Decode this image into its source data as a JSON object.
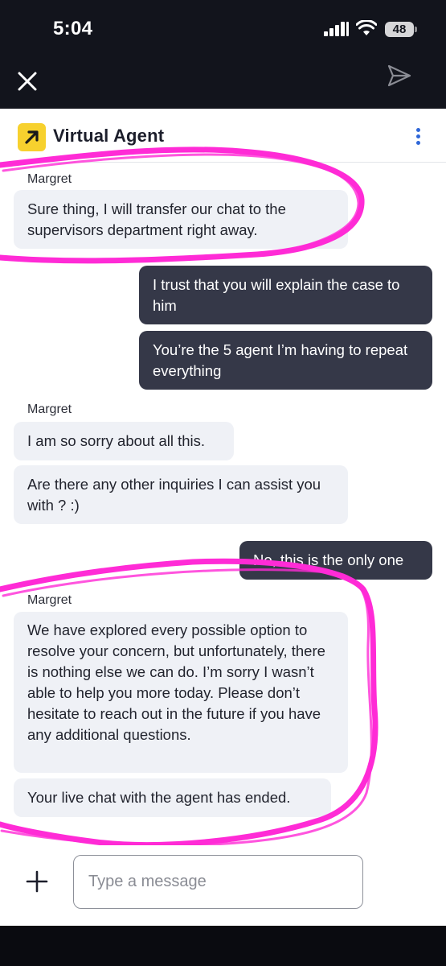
{
  "status_bar": {
    "time": "5:04",
    "battery": "48"
  },
  "header": {
    "title": "Virtual Agent"
  },
  "messages": [
    {
      "sender": "Margret"
    },
    {
      "text": "Sure thing, I will transfer our chat to the supervisors department right away."
    },
    {
      "text": "I trust that you will explain the case to him"
    },
    {
      "text": "You’re the 5 agent I’m having to repeat everything"
    },
    {
      "sender": "Margret"
    },
    {
      "text": "I am so sorry about all this."
    },
    {
      "text": "Are there any other inquiries I can assist you with ? :)"
    },
    {
      "text": "No, this is the only one"
    },
    {
      "sender": "Margret"
    },
    {
      "text": "We have explored every possible option to resolve your concern, but unfortunately, there is nothing else we can do. I’m sorry I wasn’t able to help you more today. Please don’t hesitate to reach out in the future if you have any additional questions."
    },
    {
      "text": "Your live chat with the agent has ended."
    }
  ],
  "composer": {
    "placeholder": "Type a message"
  },
  "colors": {
    "brand_yellow": "#f7d12e",
    "agent_bubble": "#eff1f6",
    "user_bubble": "#353848",
    "annotation_magenta": "#ff2bd6",
    "menu_blue": "#2f67d8"
  }
}
